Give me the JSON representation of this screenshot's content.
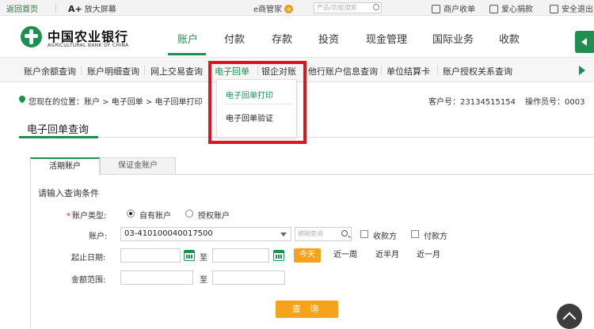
{
  "topbar": {
    "home_link": "返回首页",
    "zoom_glyph": "A+",
    "zoom_label": "放大屏幕",
    "e_manager": "e商管家",
    "e_badge": "e",
    "search_placeholder": "产品/功能搜索",
    "merchant": "商户收单",
    "donate": "爱心捐款",
    "logout": "安全退出"
  },
  "logo": {
    "name_cn": "中国农业银行",
    "name_en": "AGRICULTURAL BANK OF CHINA"
  },
  "main_nav": [
    "账户",
    "付款",
    "存款",
    "投资",
    "现金管理",
    "国际业务",
    "收款"
  ],
  "sub_nav": [
    "账户余额查询",
    "账户明细查询",
    "网上交易查询",
    "电子回单",
    "银企对账",
    "他行账户信息查询",
    "单位结算卡",
    "账户授权关系查询"
  ],
  "breadcrumb": {
    "text": "您现在的位置：账户 > 电子回单 > 电子回单打印",
    "customer_no": "客户号：23134515154",
    "operator_no": "操作员号：0003"
  },
  "dropdown": {
    "items": [
      "电子回单打印",
      "电子回单验证"
    ]
  },
  "page_title": "电子回单查询",
  "tabs": [
    "活期账户",
    "保证金账户"
  ],
  "form": {
    "heading": "请输入查询条件",
    "required_mark": "*",
    "account_type_label": "账户类型:",
    "own_account": "自有账户",
    "authorized_account": "授权账户",
    "account_label": "账户:",
    "account_value": "03-410100040017500",
    "fuzzy_placeholder": "模糊查询",
    "payee": "收款方",
    "payer": "付款方",
    "date_label": "起止日期:",
    "to": "至",
    "today": "今天",
    "last_week": "近一周",
    "half_month": "近半月",
    "last_month": "近一月",
    "amount_label": "金额范围:",
    "query_button": "查 询"
  },
  "colors": {
    "brand_green": "#1e8f4e",
    "accent_orange": "#f6a31b",
    "highlight_red": "#e1141b"
  }
}
